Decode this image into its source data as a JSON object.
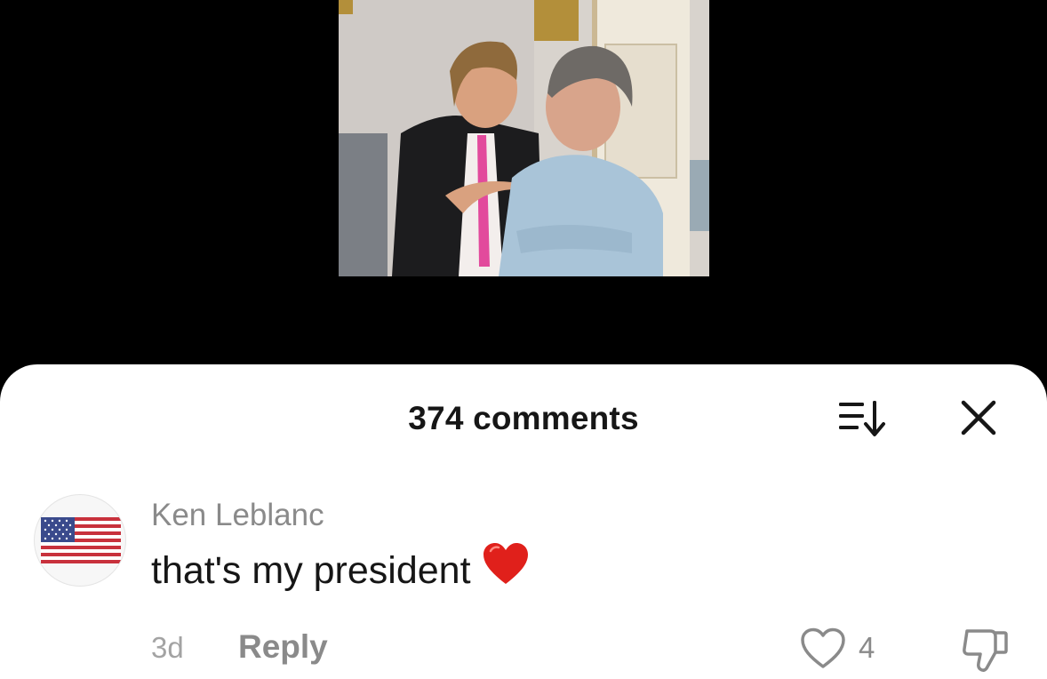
{
  "video": {
    "thumbnail": "photo of two men in suits talking in an ornate room"
  },
  "sheet": {
    "title": "374 comments",
    "sort_icon": "sort-descending-icon",
    "close_icon": "close-icon"
  },
  "comment": {
    "avatar": "us-flag-avatar",
    "username": "Ken Leblanc",
    "text": "that's my president",
    "emoji": "red-heart-emoji",
    "timestamp": "3d",
    "reply_label": "Reply",
    "like_count": "4",
    "like_icon": "heart-outline-icon",
    "dislike_icon": "thumbs-down-icon"
  },
  "colors": {
    "sheet_bg": "#ffffff",
    "text_primary": "#161616",
    "text_secondary": "#8a8a8a",
    "heart_red": "#e0201b"
  }
}
